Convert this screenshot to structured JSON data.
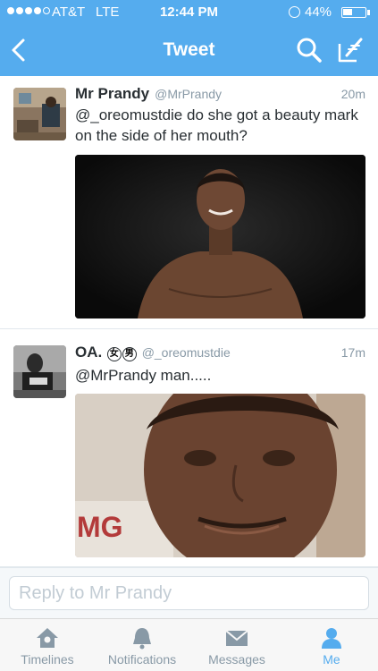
{
  "status_bar": {
    "carrier": "AT&T",
    "network": "LTE",
    "time": "12:44 PM",
    "battery_text": "44%",
    "battery_level": 0.44
  },
  "nav": {
    "title": "Tweet",
    "back_icon": "chevron-left-icon",
    "search_icon": "search-icon",
    "compose_icon": "compose-icon"
  },
  "tweets": [
    {
      "name": "Mr Prandy",
      "handle": "@MrPrandy",
      "time": "20m",
      "text": "@_oreomustdie do she got a beauty mark on the side of her mouth?"
    },
    {
      "name": "OA.",
      "badges": [
        "女",
        "男"
      ],
      "handle": "@_oreomustdie",
      "time": "17m",
      "text": "@MrPrandy man....."
    }
  ],
  "reply": {
    "placeholder": "Reply to Mr Prandy"
  },
  "tabs": [
    {
      "label": "Timelines",
      "icon": "home-icon"
    },
    {
      "label": "Notifications",
      "icon": "bell-icon"
    },
    {
      "label": "Messages",
      "icon": "envelope-icon"
    },
    {
      "label": "Me",
      "icon": "person-icon",
      "active": true
    }
  ],
  "colors": {
    "brand": "#55acee",
    "tab_inactive": "#8899a6",
    "text": "#292f33"
  }
}
